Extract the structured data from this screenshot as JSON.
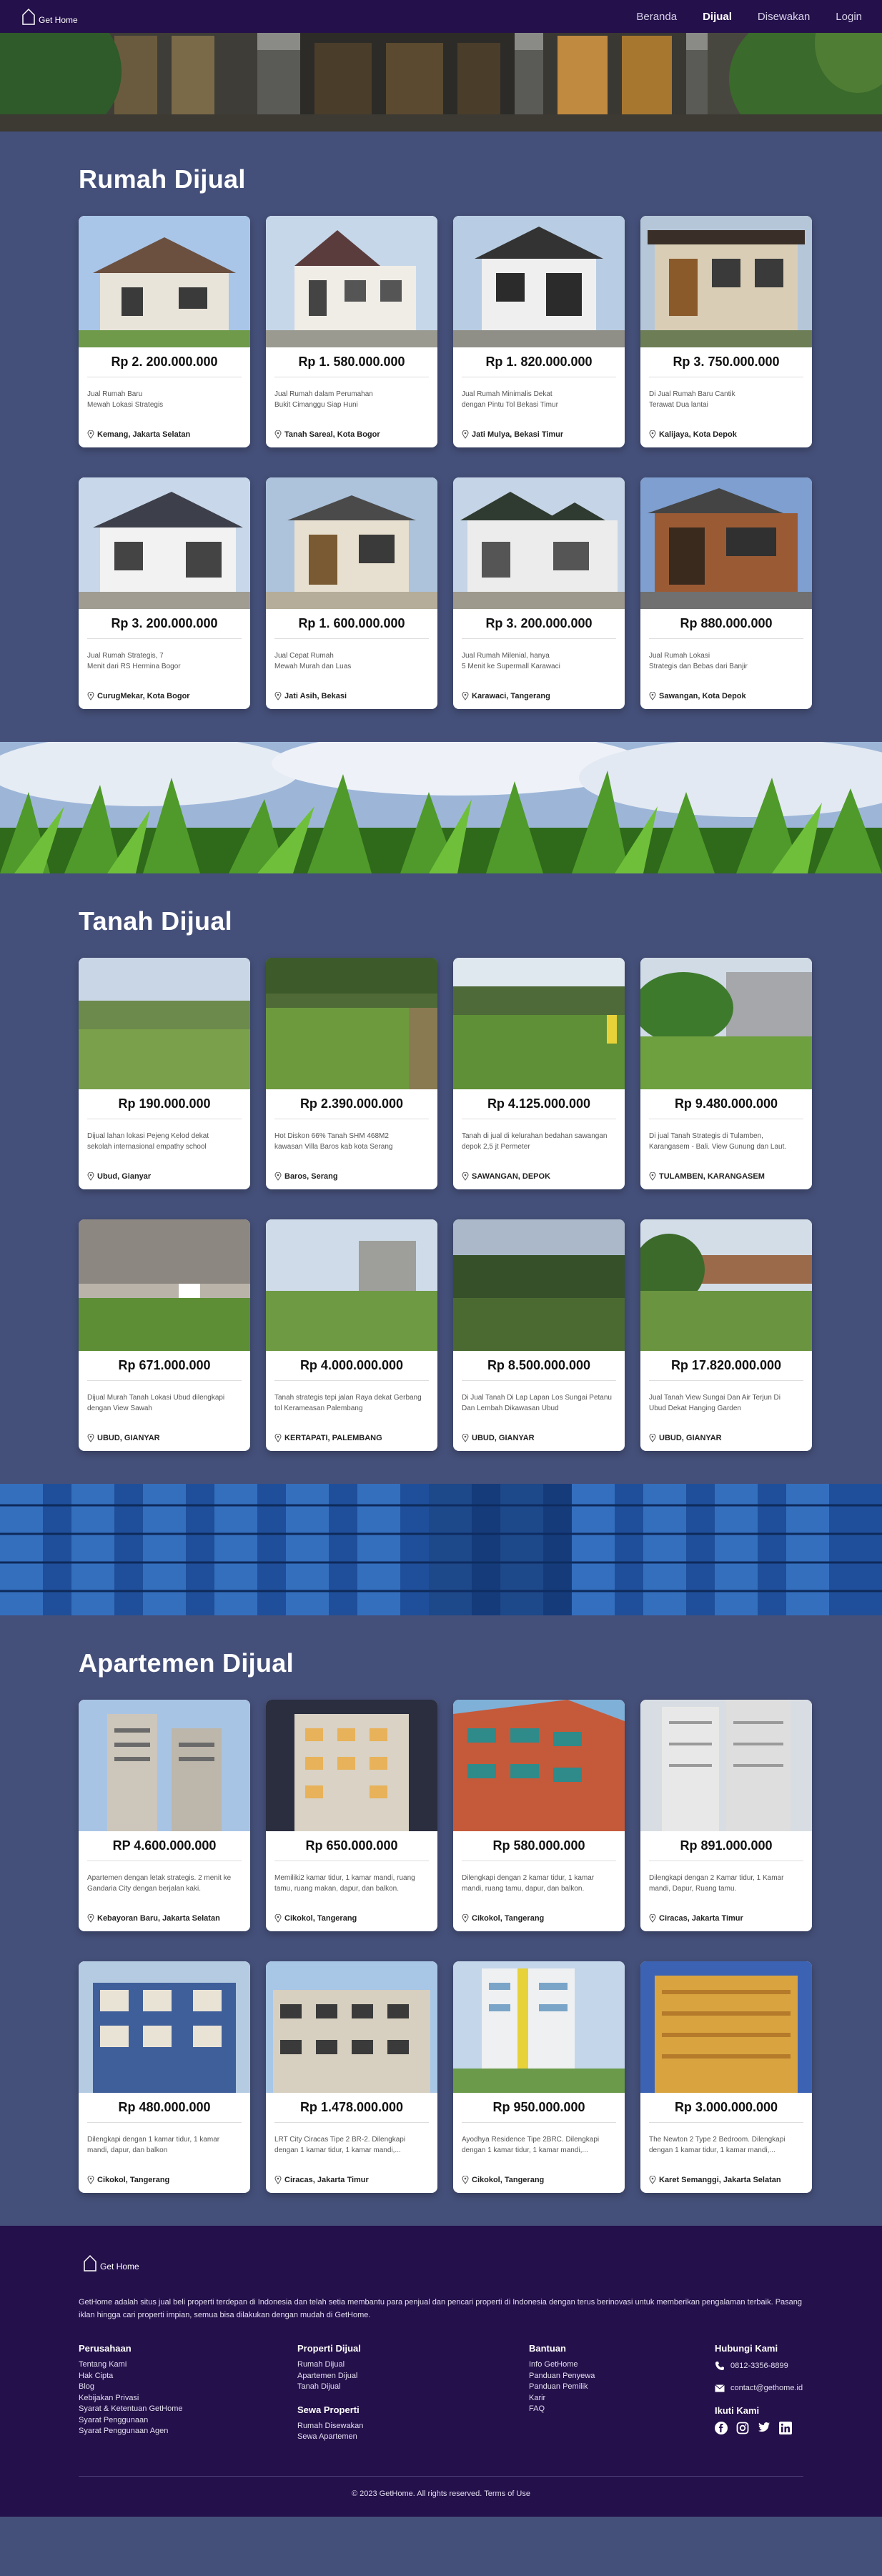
{
  "brand": {
    "name": "Get Home"
  },
  "nav": {
    "items": [
      {
        "label": "Beranda"
      },
      {
        "label": "Dijual"
      },
      {
        "label": "Disewakan"
      },
      {
        "label": "Login"
      }
    ]
  },
  "sections": [
    {
      "title": "Rumah Dijual",
      "items": [
        {
          "price": "Rp 2. 200.000.000",
          "desc1": "Jual Rumah Baru",
          "desc2": "Mewah Lokasi Strategis",
          "location": "Kemang, Jakarta Selatan"
        },
        {
          "price": "Rp 1. 580.000.000",
          "desc1": "Jual Rumah dalam Perumahan",
          "desc2": "Bukit Cimanggu Siap Huni",
          "location": "Tanah Sareal, Kota Bogor"
        },
        {
          "price": "Rp 1. 820.000.000",
          "desc1": "Jual Rumah Minimalis Dekat",
          "desc2": "dengan Pintu Tol Bekasi Timur",
          "location": "Jati Mulya, Bekasi Timur"
        },
        {
          "price": "Rp 3. 750.000.000",
          "desc1": "Di Jual Rumah Baru Cantik",
          "desc2": "Terawat Dua lantai",
          "location": "Kalijaya, Kota Depok"
        },
        {
          "price": "Rp 3. 200.000.000",
          "desc1": "Jual Rumah Strategis, 7",
          "desc2": "Menit dari RS Hermina Bogor",
          "location": "CurugMekar, Kota Bogor"
        },
        {
          "price": "Rp 1. 600.000.000",
          "desc1": "Jual Cepat Rumah",
          "desc2": "Mewah Murah dan Luas",
          "location": "Jati Asih, Bekasi"
        },
        {
          "price": "Rp 3. 200.000.000",
          "desc1": "Jual Rumah Milenial, hanya",
          "desc2": "5 Menit ke Supermall Karawaci",
          "location": "Karawaci, Tangerang"
        },
        {
          "price": "Rp 880.000.000",
          "desc1": "Jual Rumah Lokasi",
          "desc2": "Strategis dan Bebas dari Banjir",
          "location": "Sawangan, Kota Depok"
        }
      ]
    },
    {
      "title": "Tanah Dijual",
      "items": [
        {
          "price": "Rp 190.000.000",
          "desc1": "Dijual lahan lokasi Pejeng Kelod dekat",
          "desc2": "sekolah internasional empathy school",
          "location": "Ubud, Gianyar"
        },
        {
          "price": "Rp 2.390.000.000",
          "desc1": "Hot Diskon 66% Tanah SHM 468M2",
          "desc2": "kawasan Villa Baros kab kota Serang",
          "location": "Baros, Serang"
        },
        {
          "price": "Rp 4.125.000.000",
          "desc1": "Tanah di jual di kelurahan bedahan sawangan",
          "desc2": "depok 2,5 jt Permeter",
          "location": "SAWANGAN, DEPOK"
        },
        {
          "price": "Rp 9.480.000.000",
          "desc1": "Di jual Tanah Strategis di Tulamben,",
          "desc2": "Karangasem - Bali. View Gunung dan Laut.",
          "location": "TULAMBEN, KARANGASEM"
        },
        {
          "price": "Rp 671.000.000",
          "desc1": "Dijual Murah Tanah Lokasi Ubud dilengkapi",
          "desc2": "dengan View Sawah",
          "location": "UBUD, GIANYAR"
        },
        {
          "price": "Rp 4.000.000.000",
          "desc1": "Tanah strategis tepi jalan Raya dekat Gerbang",
          "desc2": "tol Kerameasan Palembang",
          "location": "KERTAPATI, PALEMBANG"
        },
        {
          "price": "Rp 8.500.000.000",
          "desc1": "Di Jual Tanah Di Lap Lapan Los Sungai Petanu",
          "desc2": "Dan Lembah Dikawasan Ubud",
          "location": "UBUD, GIANYAR"
        },
        {
          "price": "Rp 17.820.000.000",
          "desc1": "Jual Tanah View Sungai Dan Air Terjun Di",
          "desc2": "Ubud Dekat Hanging Garden",
          "location": "UBUD, GIANYAR"
        }
      ]
    },
    {
      "title": "Apartemen Dijual",
      "items": [
        {
          "price": "RP 4.600.000.000",
          "desc1": "Apartemen dengan letak strategis. 2 menit ke",
          "desc2": "Gandaria City dengan berjalan kaki.",
          "location": "Kebayoran Baru, Jakarta Selatan"
        },
        {
          "price": "Rp 650.000.000",
          "desc1": "Memiliki2 kamar tidur, 1 kamar mandi, ruang",
          "desc2": "tamu, ruang makan, dapur, dan balkon.",
          "location": "Cikokol, Tangerang"
        },
        {
          "price": "Rp 580.000.000",
          "desc1": "Dilengkapi dengan 2 kamar tidur, 1 kamar",
          "desc2": "mandi, ruang tamu, dapur, dan balkon.",
          "location": "Cikokol, Tangerang"
        },
        {
          "price": "Rp 891.000.000",
          "desc1": "Dilengkapi dengan 2 Kamar tidur, 1 Kamar",
          "desc2": "mandi, Dapur, Ruang tamu.",
          "location": "Ciracas, Jakarta Timur"
        },
        {
          "price": "Rp 480.000.000",
          "desc1": "Dilengkapi dengan 1 kamar tidur, 1 kamar",
          "desc2": "mandi, dapur, dan balkon",
          "location": "Cikokol, Tangerang"
        },
        {
          "price": "Rp 1.478.000.000",
          "desc1": "LRT City Ciracas Tipe 2 BR-2. Dilengkapi",
          "desc2": "dengan 1 kamar tidur, 1 kamar mandi,...",
          "location": "Ciracas, Jakarta Timur"
        },
        {
          "price": "Rp 950.000.000",
          "desc1": "Ayodhya Residence Tipe 2BRC. Dilengkapi",
          "desc2": "dengan 1 kamar tidur, 1 kamar mandi,...",
          "location": "Cikokol, Tangerang"
        },
        {
          "price": "Rp 3.000.000.000",
          "desc1": "The Newton 2 Type 2 Bedroom. Dilengkapi",
          "desc2": "dengan 1 kamar tidur, 1 kamar mandi,...",
          "location": "Karet Semanggi, Jakarta Selatan"
        }
      ]
    }
  ],
  "footer": {
    "about": "GetHome adalah situs jual beli properti terdepan di Indonesia dan telah setia membantu para penjual dan pencari properti di Indonesia dengan terus berinovasi untuk memberikan pengalaman terbaik. Pasang iklan hingga cari properti impian, semua bisa dilakukan dengan mudah di GetHome.",
    "perusahaan": {
      "title": "Perusahaan",
      "links": [
        "Tentang Kami",
        "Hak Cipta",
        "Blog",
        "Kebijakan Privasi",
        "Syarat & Ketentuan GetHome",
        "Syarat Penggunaan",
        "Syarat Penggunaan Agen"
      ]
    },
    "properti_dijual": {
      "title": "Properti Dijual",
      "links": [
        "Rumah Dijual",
        "Apartemen Dijual",
        "Tanah Dijual"
      ]
    },
    "sewa": {
      "title": "Sewa Properti",
      "links": [
        "Rumah Disewakan",
        "Sewa Apartemen"
      ]
    },
    "bantuan": {
      "title": "Bantuan",
      "links": [
        "Info GetHome",
        "Panduan Penyewa",
        "Panduan Pemilik",
        "Karir",
        "FAQ"
      ]
    },
    "hubungi": {
      "title": "Hubungi Kami",
      "phone": "0812-3356-8899",
      "email": "contact@gethome.id"
    },
    "ikuti": {
      "title": "Ikuti Kami",
      "icons": [
        "facebook-icon",
        "instagram-icon",
        "twitter-icon",
        "linkedin-icon"
      ]
    },
    "copyright": "© 2023 GetHome. All rights reserved. Terms of Use"
  }
}
